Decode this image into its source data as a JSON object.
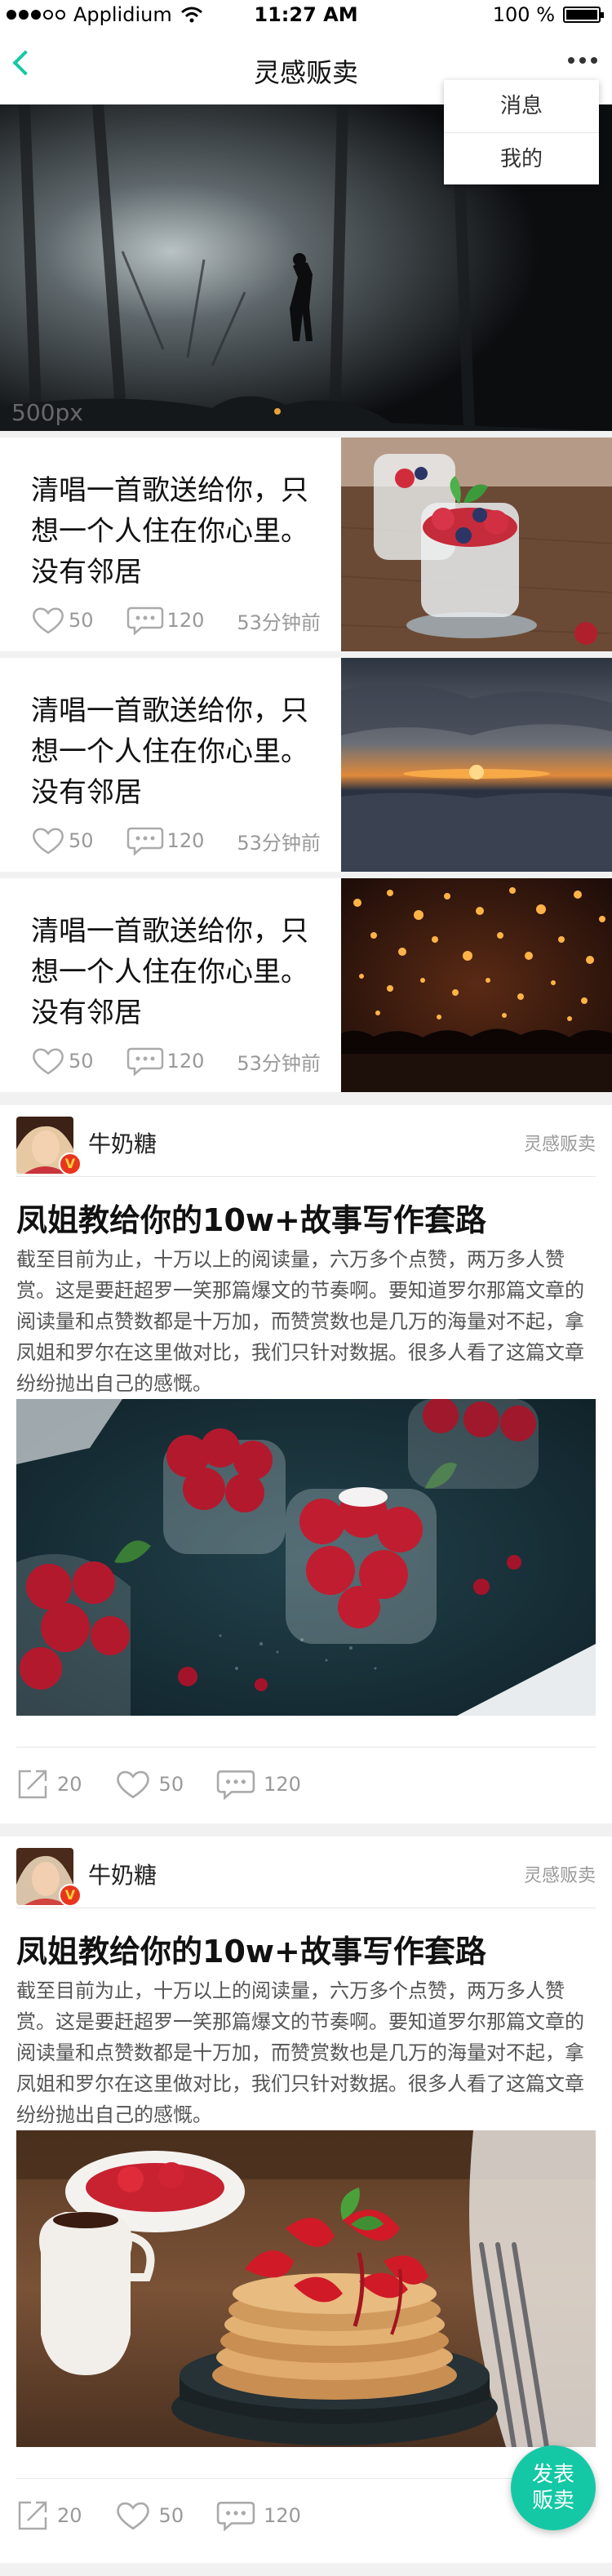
{
  "status_bar": {
    "carrier": "Applidium",
    "time": "11:27 AM",
    "battery": "100 %"
  },
  "nav": {
    "title": "灵感贩卖"
  },
  "menu": {
    "items": [
      "消息",
      "我的"
    ]
  },
  "hero": {
    "watermark": "500px"
  },
  "list": [
    {
      "title": "清唱一首歌送给你，只想一个人住在你心里。没有邻居",
      "likes": "50",
      "comments": "120",
      "time": "53分钟前"
    },
    {
      "title": "清唱一首歌送给你，只想一个人住在你心里。没有邻居",
      "likes": "50",
      "comments": "120",
      "time": "53分钟前"
    },
    {
      "title": "清唱一首歌送给你，只想一个人住在你心里。没有邻居",
      "likes": "50",
      "comments": "120",
      "time": "53分钟前"
    }
  ],
  "articles": [
    {
      "author": "牛奶糖",
      "badge": "V",
      "source": "灵感贩卖",
      "title": "凤姐教给你的10w+故事写作套路",
      "body": "截至目前为止，十万以上的阅读量，六万多个点赞，两万多人赞赏。这是要赶超罗一笑那篇爆文的节奏啊。要知道罗尔那篇文章的阅读量和点赞数都是十万加，而赞赏数也是几万的海量对不起，拿凤姐和罗尔在这里做对比，我们只针对数据。很多人看了这篇文章纷纷抛出自己的感慨。",
      "shares": "20",
      "likes": "50",
      "comments": "120"
    },
    {
      "author": "牛奶糖",
      "badge": "V",
      "source": "灵感贩卖",
      "title": "凤姐教给你的10w+故事写作套路",
      "body": "截至目前为止，十万以上的阅读量，六万多个点赞，两万多人赞赏。这是要赶超罗一笑那篇爆文的节奏啊。要知道罗尔那篇文章的阅读量和点赞数都是十万加，而赞赏数也是几万的海量对不起，拿凤姐和罗尔在这里做对比，我们只针对数据。很多人看了这篇文章纷纷抛出自己的感慨。",
      "shares": "20",
      "likes": "50",
      "comments": "120"
    }
  ],
  "fab": {
    "line1": "发表",
    "line2": "贩卖"
  },
  "colors": {
    "accent": "#15c8a5",
    "badge": "#e8361e"
  }
}
